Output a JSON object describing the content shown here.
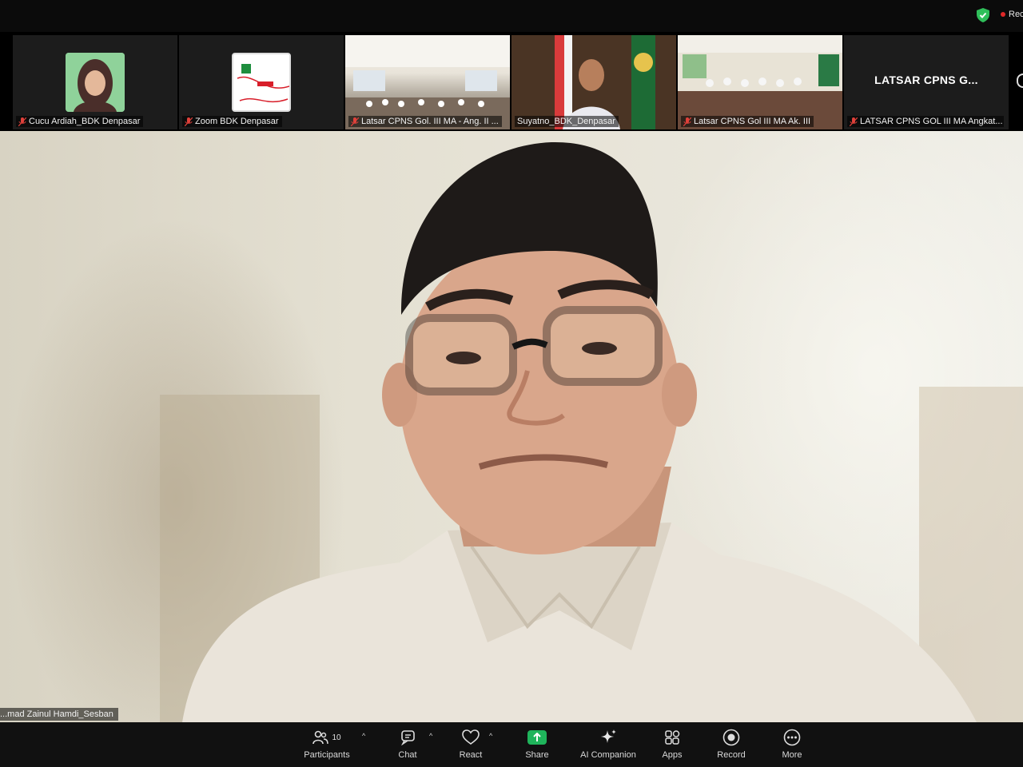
{
  "status": {
    "recording_label": "Rec"
  },
  "participants_strip": [
    {
      "caption": "Cucu Ardiah_BDK Denpasar",
      "muted": true
    },
    {
      "caption": "Zoom BDK Denpasar",
      "muted": true
    },
    {
      "caption": "Latsar CPNS Gol. III MA - Ang. II ...",
      "muted": true
    },
    {
      "caption": "Suyatno_BDK_Denpasar",
      "muted": false
    },
    {
      "caption": "Latsar CPNS Gol III MA Ak. III",
      "muted": true
    },
    {
      "caption": "LATSAR CPNS GOL III MA Angkat...",
      "muted": true,
      "display_name": "LATSAR CPNS G..."
    }
  ],
  "main_speaker": {
    "caption": "...mad Zainul Hamdi_Sesban"
  },
  "toolbar": {
    "participants": {
      "label": "Participants",
      "count": "10"
    },
    "chat": {
      "label": "Chat"
    },
    "react": {
      "label": "React"
    },
    "share": {
      "label": "Share"
    },
    "ai_companion": {
      "label": "AI Companion"
    },
    "apps": {
      "label": "Apps"
    },
    "record": {
      "label": "Record"
    },
    "more": {
      "label": "More"
    }
  },
  "colors": {
    "share_green": "#1fb45b",
    "muted_red": "#e0403a",
    "shield_green": "#2fbf5a",
    "rec_red": "#e02828"
  }
}
